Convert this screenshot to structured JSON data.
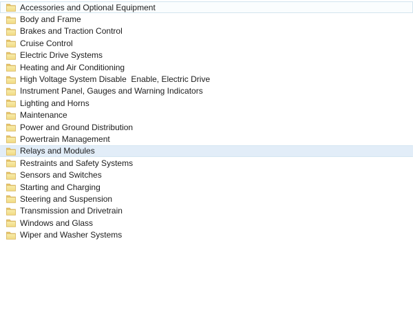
{
  "window": {
    "background": "#FFFFFF"
  },
  "tree": {
    "items": [
      {
        "label": "Accessories and Optional Equipment",
        "state": "focused"
      },
      {
        "label": "Body and Frame",
        "state": "normal"
      },
      {
        "label": "Brakes and Traction Control",
        "state": "normal"
      },
      {
        "label": "Cruise Control",
        "state": "normal"
      },
      {
        "label": "Electric Drive Systems",
        "state": "normal"
      },
      {
        "label": "Heating and Air Conditioning",
        "state": "normal"
      },
      {
        "label": "High Voltage System Disable  Enable, Electric Drive",
        "state": "normal"
      },
      {
        "label": "Instrument Panel, Gauges and Warning Indicators",
        "state": "normal"
      },
      {
        "label": "Lighting and Horns",
        "state": "normal"
      },
      {
        "label": "Maintenance",
        "state": "normal"
      },
      {
        "label": "Power and Ground Distribution",
        "state": "normal"
      },
      {
        "label": "Powertrain Management",
        "state": "normal"
      },
      {
        "label": "Relays and Modules",
        "state": "selected"
      },
      {
        "label": "Restraints and Safety Systems",
        "state": "normal"
      },
      {
        "label": "Sensors and Switches",
        "state": "normal"
      },
      {
        "label": "Starting and Charging",
        "state": "normal"
      },
      {
        "label": "Steering and Suspension",
        "state": "normal"
      },
      {
        "label": "Transmission and Drivetrain",
        "state": "normal"
      },
      {
        "label": "Windows and Glass",
        "state": "normal"
      },
      {
        "label": "Wiper and Washer Systems",
        "state": "normal"
      }
    ],
    "selected_item": "Relays and Modules",
    "focused_item": "Accessories and Optional Equipment",
    "icon": "folder-icon",
    "colors": {
      "selected_bg": "#E2EDF8",
      "selected_border": "#D4E5F2",
      "focused_bg": "#FAFDFE",
      "focused_border": "#D2E4EE",
      "text": "#1C1C1C",
      "folder_back": "#E9C96E",
      "folder_front_top": "#F8ECAC",
      "folder_front_bottom": "#F1DA82",
      "folder_outline": "#D4AE55"
    }
  }
}
